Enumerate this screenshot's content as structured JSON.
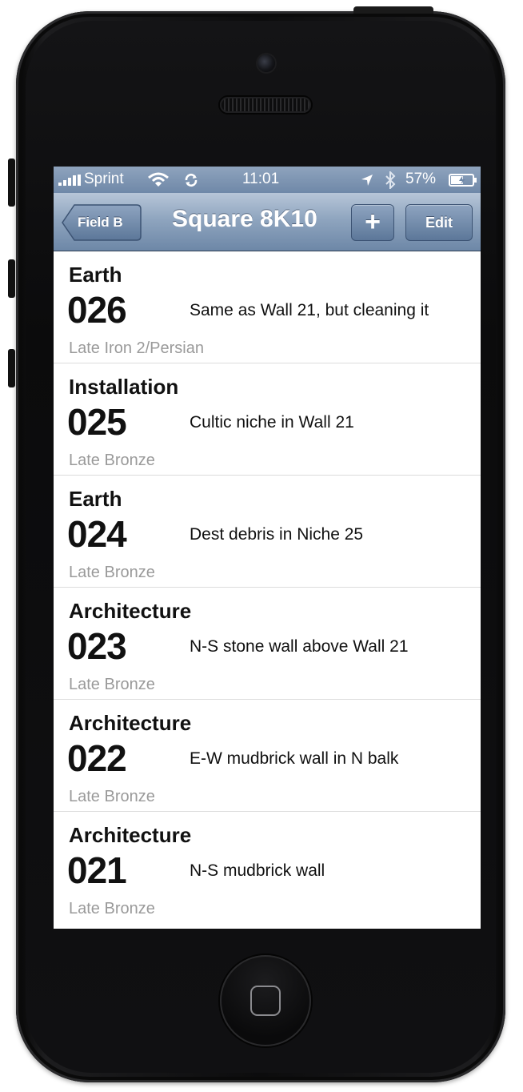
{
  "status_bar": {
    "carrier": "Sprint",
    "time": "11:01",
    "battery": "57%",
    "battery_level": 0.57
  },
  "nav_bar": {
    "back_label": "Field B",
    "title": "Square 8K10",
    "add_label": "+",
    "edit_label": "Edit"
  },
  "loci": [
    {
      "type": "Earth",
      "number": "026",
      "description": "Same as Wall 21, but cleaning it",
      "period": "Late Iron 2/Persian"
    },
    {
      "type": "Installation",
      "number": "025",
      "description": "Cultic niche in Wall 21",
      "period": "Late Bronze"
    },
    {
      "type": "Earth",
      "number": "024",
      "description": "Dest debris in Niche 25",
      "period": "Late Bronze"
    },
    {
      "type": "Architecture",
      "number": "023",
      "description": "N-S stone wall above Wall 21",
      "period": "Late Bronze"
    },
    {
      "type": "Architecture",
      "number": "022",
      "description": "E-W mudbrick wall in N balk",
      "period": "Late Bronze"
    },
    {
      "type": "Architecture",
      "number": "021",
      "description": "N-S mudbrick wall",
      "period": "Late Bronze"
    }
  ]
}
